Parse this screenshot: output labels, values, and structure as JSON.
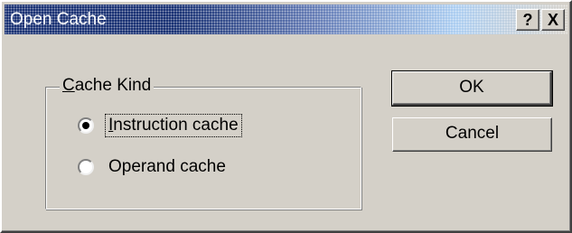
{
  "window": {
    "title": "Open Cache",
    "help_label": "?",
    "close_label": "X"
  },
  "cache_kind_group": {
    "label_mnemonic": "C",
    "label_rest": "ache Kind",
    "options": [
      {
        "mnemonic": "I",
        "rest": "nstruction cache",
        "selected": true
      },
      {
        "mnemonic": "",
        "rest": "Operand cache",
        "selected": false
      }
    ]
  },
  "buttons": {
    "ok_label": "OK",
    "cancel_label": "Cancel"
  }
}
